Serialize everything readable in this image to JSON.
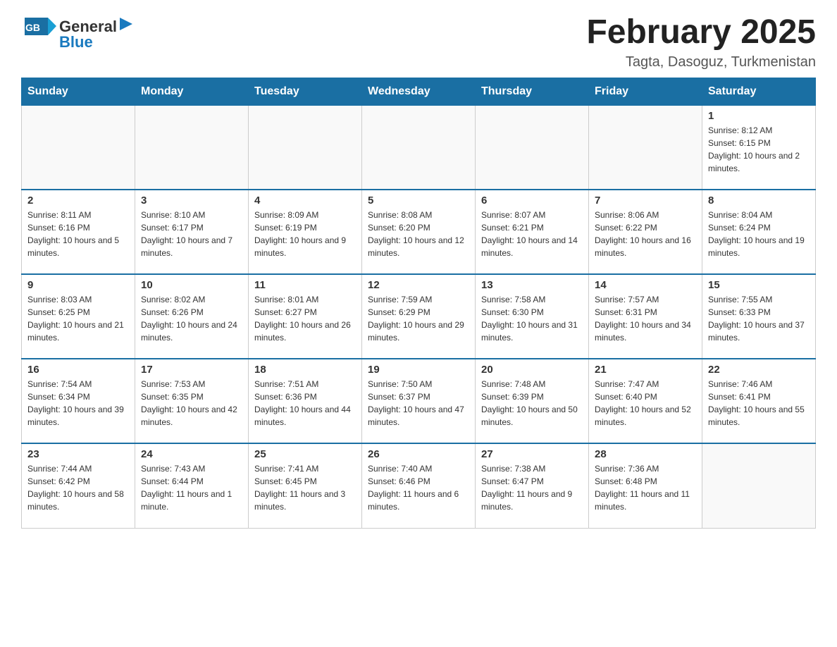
{
  "header": {
    "logo": {
      "text_general": "General",
      "text_blue": "Blue",
      "logo_alt": "GeneralBlue logo"
    },
    "title": "February 2025",
    "subtitle": "Tagta, Dasoguz, Turkmenistan"
  },
  "weekdays": [
    "Sunday",
    "Monday",
    "Tuesday",
    "Wednesday",
    "Thursday",
    "Friday",
    "Saturday"
  ],
  "weeks": [
    [
      {
        "day": "",
        "info": ""
      },
      {
        "day": "",
        "info": ""
      },
      {
        "day": "",
        "info": ""
      },
      {
        "day": "",
        "info": ""
      },
      {
        "day": "",
        "info": ""
      },
      {
        "day": "",
        "info": ""
      },
      {
        "day": "1",
        "info": "Sunrise: 8:12 AM\nSunset: 6:15 PM\nDaylight: 10 hours and 2 minutes."
      }
    ],
    [
      {
        "day": "2",
        "info": "Sunrise: 8:11 AM\nSunset: 6:16 PM\nDaylight: 10 hours and 5 minutes."
      },
      {
        "day": "3",
        "info": "Sunrise: 8:10 AM\nSunset: 6:17 PM\nDaylight: 10 hours and 7 minutes."
      },
      {
        "day": "4",
        "info": "Sunrise: 8:09 AM\nSunset: 6:19 PM\nDaylight: 10 hours and 9 minutes."
      },
      {
        "day": "5",
        "info": "Sunrise: 8:08 AM\nSunset: 6:20 PM\nDaylight: 10 hours and 12 minutes."
      },
      {
        "day": "6",
        "info": "Sunrise: 8:07 AM\nSunset: 6:21 PM\nDaylight: 10 hours and 14 minutes."
      },
      {
        "day": "7",
        "info": "Sunrise: 8:06 AM\nSunset: 6:22 PM\nDaylight: 10 hours and 16 minutes."
      },
      {
        "day": "8",
        "info": "Sunrise: 8:04 AM\nSunset: 6:24 PM\nDaylight: 10 hours and 19 minutes."
      }
    ],
    [
      {
        "day": "9",
        "info": "Sunrise: 8:03 AM\nSunset: 6:25 PM\nDaylight: 10 hours and 21 minutes."
      },
      {
        "day": "10",
        "info": "Sunrise: 8:02 AM\nSunset: 6:26 PM\nDaylight: 10 hours and 24 minutes."
      },
      {
        "day": "11",
        "info": "Sunrise: 8:01 AM\nSunset: 6:27 PM\nDaylight: 10 hours and 26 minutes."
      },
      {
        "day": "12",
        "info": "Sunrise: 7:59 AM\nSunset: 6:29 PM\nDaylight: 10 hours and 29 minutes."
      },
      {
        "day": "13",
        "info": "Sunrise: 7:58 AM\nSunset: 6:30 PM\nDaylight: 10 hours and 31 minutes."
      },
      {
        "day": "14",
        "info": "Sunrise: 7:57 AM\nSunset: 6:31 PM\nDaylight: 10 hours and 34 minutes."
      },
      {
        "day": "15",
        "info": "Sunrise: 7:55 AM\nSunset: 6:33 PM\nDaylight: 10 hours and 37 minutes."
      }
    ],
    [
      {
        "day": "16",
        "info": "Sunrise: 7:54 AM\nSunset: 6:34 PM\nDaylight: 10 hours and 39 minutes."
      },
      {
        "day": "17",
        "info": "Sunrise: 7:53 AM\nSunset: 6:35 PM\nDaylight: 10 hours and 42 minutes."
      },
      {
        "day": "18",
        "info": "Sunrise: 7:51 AM\nSunset: 6:36 PM\nDaylight: 10 hours and 44 minutes."
      },
      {
        "day": "19",
        "info": "Sunrise: 7:50 AM\nSunset: 6:37 PM\nDaylight: 10 hours and 47 minutes."
      },
      {
        "day": "20",
        "info": "Sunrise: 7:48 AM\nSunset: 6:39 PM\nDaylight: 10 hours and 50 minutes."
      },
      {
        "day": "21",
        "info": "Sunrise: 7:47 AM\nSunset: 6:40 PM\nDaylight: 10 hours and 52 minutes."
      },
      {
        "day": "22",
        "info": "Sunrise: 7:46 AM\nSunset: 6:41 PM\nDaylight: 10 hours and 55 minutes."
      }
    ],
    [
      {
        "day": "23",
        "info": "Sunrise: 7:44 AM\nSunset: 6:42 PM\nDaylight: 10 hours and 58 minutes."
      },
      {
        "day": "24",
        "info": "Sunrise: 7:43 AM\nSunset: 6:44 PM\nDaylight: 11 hours and 1 minute."
      },
      {
        "day": "25",
        "info": "Sunrise: 7:41 AM\nSunset: 6:45 PM\nDaylight: 11 hours and 3 minutes."
      },
      {
        "day": "26",
        "info": "Sunrise: 7:40 AM\nSunset: 6:46 PM\nDaylight: 11 hours and 6 minutes."
      },
      {
        "day": "27",
        "info": "Sunrise: 7:38 AM\nSunset: 6:47 PM\nDaylight: 11 hours and 9 minutes."
      },
      {
        "day": "28",
        "info": "Sunrise: 7:36 AM\nSunset: 6:48 PM\nDaylight: 11 hours and 11 minutes."
      },
      {
        "day": "",
        "info": ""
      }
    ]
  ]
}
